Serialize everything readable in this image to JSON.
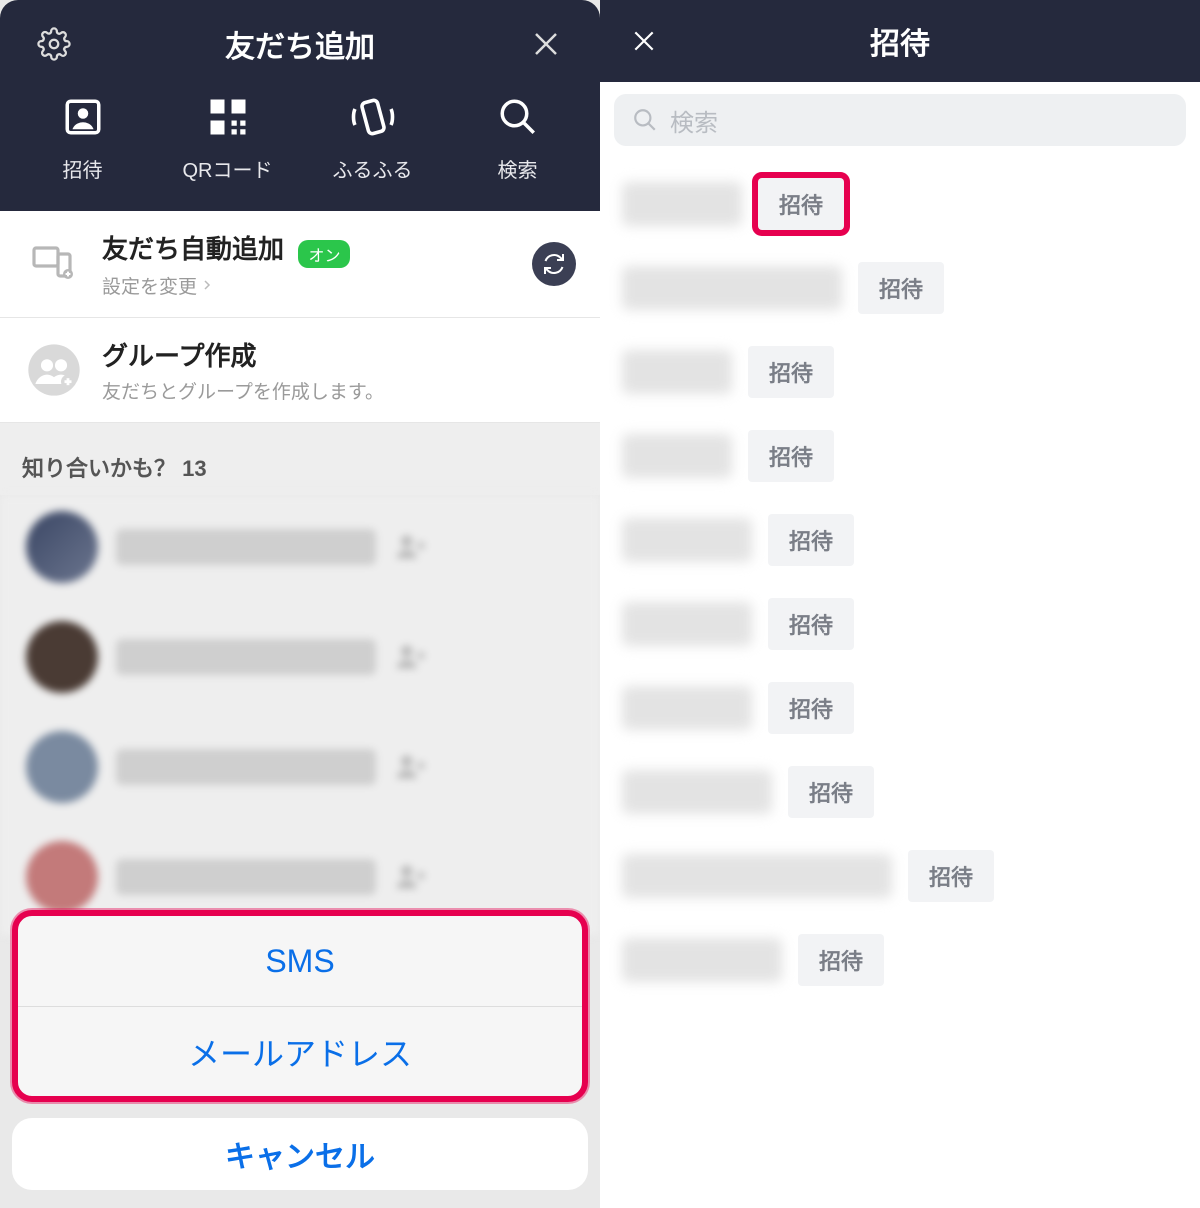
{
  "left": {
    "header_title": "友だち追加",
    "actions": {
      "invite": "招待",
      "qr": "QRコード",
      "shake": "ふるふる",
      "search": "検索"
    },
    "auto_add": {
      "title": "友だち自動追加",
      "badge": "オン",
      "sub": "設定を変更"
    },
    "group_create": {
      "title": "グループ作成",
      "sub": "友だちとグループを作成します。"
    },
    "maybe_know": "知り合いかも？ 13",
    "sheet": {
      "sms": "SMS",
      "email": "メールアドレス",
      "cancel": "キャンセル"
    }
  },
  "right": {
    "header_title": "招待",
    "search_placeholder": "検索",
    "invite_label": "招待"
  }
}
